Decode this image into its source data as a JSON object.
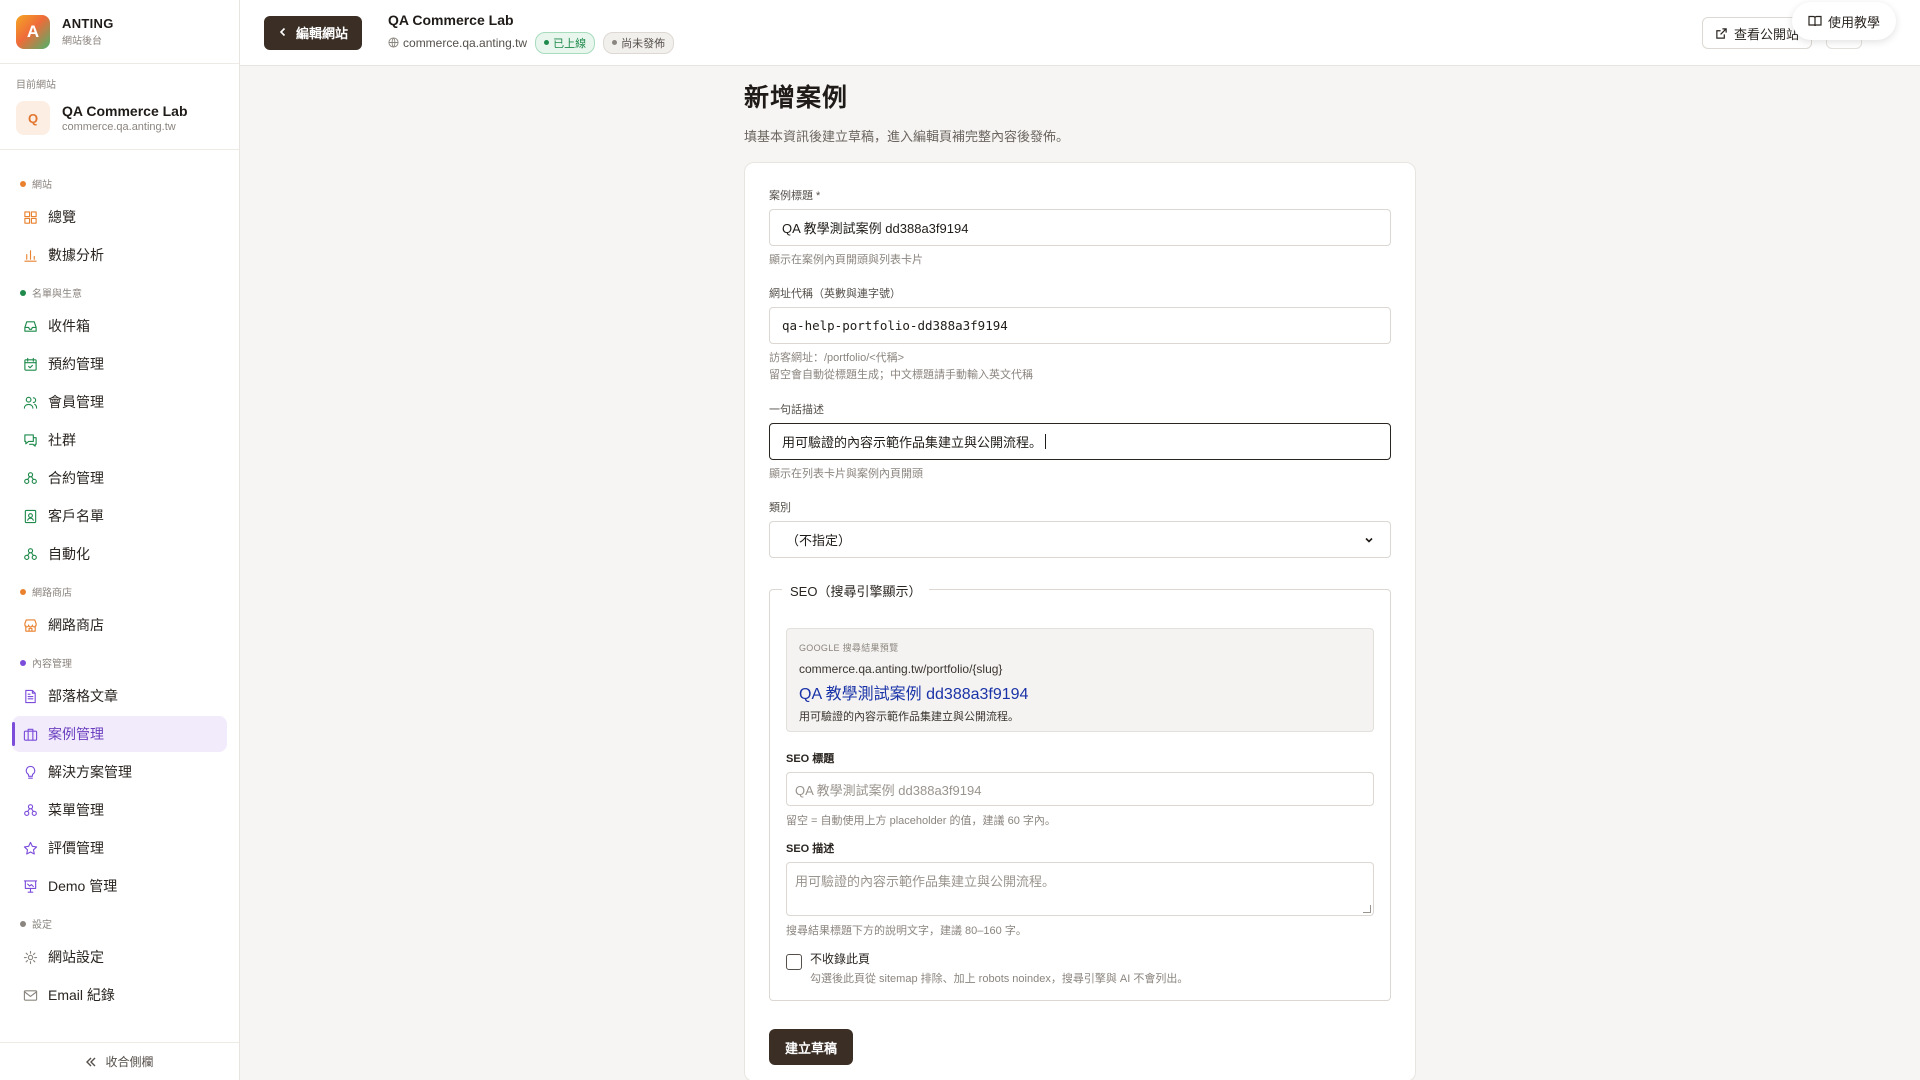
{
  "brand": {
    "logo_letter": "A",
    "name": "ANTING",
    "subtitle": "網站後台"
  },
  "current_site": {
    "caption": "目前網站",
    "avatar_letter": "Q",
    "name": "QA Commerce Lab",
    "domain": "commerce.qa.anting.tw"
  },
  "sidebar": {
    "sections": [
      {
        "title": "網站",
        "dot_color": "#e9822f",
        "items": [
          {
            "label": "總覽",
            "icon": "grid-icon",
            "color": "#e9822f"
          },
          {
            "label": "數據分析",
            "icon": "bar-chart-icon",
            "color": "#e9822f"
          }
        ]
      },
      {
        "title": "名單與生意",
        "dot_color": "#1f8a4c",
        "items": [
          {
            "label": "收件箱",
            "icon": "inbox-icon",
            "color": "#1f8a4c"
          },
          {
            "label": "預約管理",
            "icon": "calendar-icon",
            "color": "#1f8a4c"
          },
          {
            "label": "會員管理",
            "icon": "users-icon",
            "color": "#1f8a4c"
          },
          {
            "label": "社群",
            "icon": "chat-icon",
            "color": "#1f8a4c"
          },
          {
            "label": "合約管理",
            "icon": "workflow-icon",
            "color": "#1f8a4c"
          },
          {
            "label": "客戶名單",
            "icon": "contact-icon",
            "color": "#1f8a4c"
          },
          {
            "label": "自動化",
            "icon": "workflow-icon",
            "color": "#1f8a4c"
          }
        ]
      },
      {
        "title": "網路商店",
        "dot_color": "#e9822f",
        "items": [
          {
            "label": "網路商店",
            "icon": "store-icon",
            "color": "#e9822f"
          }
        ]
      },
      {
        "title": "內容管理",
        "dot_color": "#7c4ddb",
        "items": [
          {
            "label": "部落格文章",
            "icon": "document-icon",
            "color": "#7c4ddb"
          },
          {
            "label": "案例管理",
            "icon": "briefcase-icon",
            "color": "#7c4ddb",
            "active": true
          },
          {
            "label": "解決方案管理",
            "icon": "lightbulb-icon",
            "color": "#7c4ddb"
          },
          {
            "label": "菜單管理",
            "icon": "workflow-icon",
            "color": "#7c4ddb"
          },
          {
            "label": "評價管理",
            "icon": "star-icon",
            "color": "#7c4ddb"
          },
          {
            "label": "Demo 管理",
            "icon": "presentation-icon",
            "color": "#7c4ddb"
          }
        ]
      },
      {
        "title": "設定",
        "dot_color": "#8b857f",
        "items": [
          {
            "label": "網站設定",
            "icon": "gear-icon",
            "color": "#8b857f"
          },
          {
            "label": "Email 紀錄",
            "icon": "mail-icon",
            "color": "#8b857f"
          }
        ]
      }
    ],
    "collapse_label": "收合側欄"
  },
  "header": {
    "back_label": "編輯網站",
    "site_title": "QA Commerce Lab",
    "site_domain": "commerce.qa.anting.tw",
    "badge_live": "已上線",
    "badge_draft": "尚未發佈",
    "view_site_label": "查看公開站",
    "help_label": "使用教學"
  },
  "page": {
    "title": "新增案例",
    "subtitle": "填基本資訊後建立草稿，進入編輯頁補完整內容後發佈。"
  },
  "form": {
    "title_label": "案例標題 *",
    "title_value": "QA 教學測試案例 dd388a3f9194",
    "title_hint": "顯示在案例內頁開頭與列表卡片",
    "slug_label": "網址代稱（英數與連字號）",
    "slug_value": "qa-help-portfolio-dd388a3f9194",
    "slug_hint_1": "訪客網址：/portfolio/<代稱>",
    "slug_hint_2": "留空會自動從標題生成；中文標題請手動輸入英文代稱",
    "summary_label": "一句話描述",
    "summary_value": "用可驗證的內容示範作品集建立與公開流程。",
    "summary_hint": "顯示在列表卡片與案例內頁開頭",
    "category_label": "類別",
    "category_value": "（不指定）",
    "seo": {
      "legend": "SEO（搜尋引擎顯示）",
      "preview_caption": "GOOGLE 搜尋結果預覽",
      "preview_url": "commerce.qa.anting.tw/portfolio/{slug}",
      "preview_title": "QA 教學測試案例 dd388a3f9194",
      "preview_desc": "用可驗證的內容示範作品集建立與公開流程。",
      "seo_title_label": "SEO 標題",
      "seo_title_placeholder": "QA 教學測試案例 dd388a3f9194",
      "seo_title_hint": "留空 = 自動使用上方 placeholder 的值，建議 60 字內。",
      "seo_desc_label": "SEO 描述",
      "seo_desc_placeholder": "用可驗證的內容示範作品集建立與公開流程。",
      "seo_desc_hint": "搜尋結果標題下方的說明文字，建議 80–160 字。",
      "noindex_label": "不收錄此頁",
      "noindex_hint": "勾選後此頁從 sitemap 排除、加上 robots noindex，搜尋引擎與 AI 不會列出。"
    },
    "submit_label": "建立草稿"
  }
}
